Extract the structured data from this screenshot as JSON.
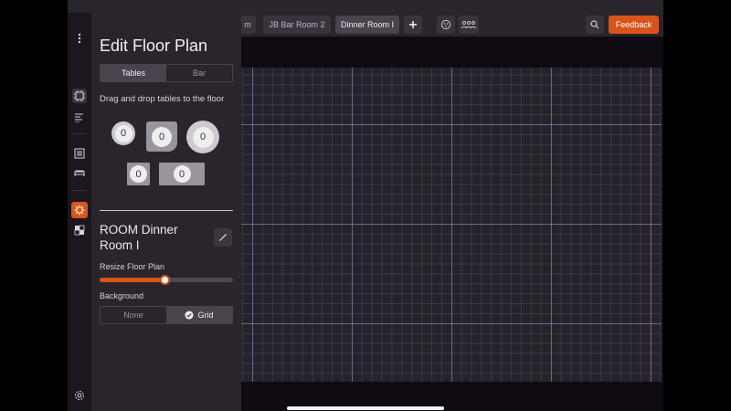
{
  "topbar": {
    "tabs": [
      {
        "label": "m",
        "active": false
      },
      {
        "label": "JB Bar Room 2",
        "active": false
      },
      {
        "label": "Dinner Room I",
        "active": true
      }
    ],
    "add_icon": "plus-icon",
    "table_view_icon": "circle-grid-icon",
    "seating_icon": "people-icon",
    "search_icon": "search-icon",
    "feedback_label": "Feedback"
  },
  "rail": {
    "items": [
      "more-vertical-icon",
      "floor-plan-icon",
      "list-align-icon",
      "menu-list-icon",
      "bed-icon",
      "table-settings-icon",
      "layers-icon",
      "settings-icon"
    ]
  },
  "panel": {
    "title": "Edit Floor Plan",
    "tabs": [
      "Tables",
      "Bar"
    ],
    "active_tab": "Tables",
    "hint": "Drag and drop tables to the floor",
    "tables": [
      {
        "shape": "round-small",
        "count": "0"
      },
      {
        "shape": "square-rounded",
        "count": "0"
      },
      {
        "shape": "round-large",
        "count": "0"
      },
      {
        "shape": "square-small",
        "count": "0"
      },
      {
        "shape": "rectangle",
        "count": "0"
      }
    ],
    "room_name": "ROOM Dinner Room I",
    "resize_label": "Resize Floor Plan",
    "resize_value": 0.49,
    "background_label": "Background",
    "background_options": [
      "None",
      "Grid"
    ],
    "background_selected": "Grid"
  },
  "colors": {
    "accent": "#d9541a",
    "panel": "#2a242c",
    "canvas": "#26222b"
  }
}
